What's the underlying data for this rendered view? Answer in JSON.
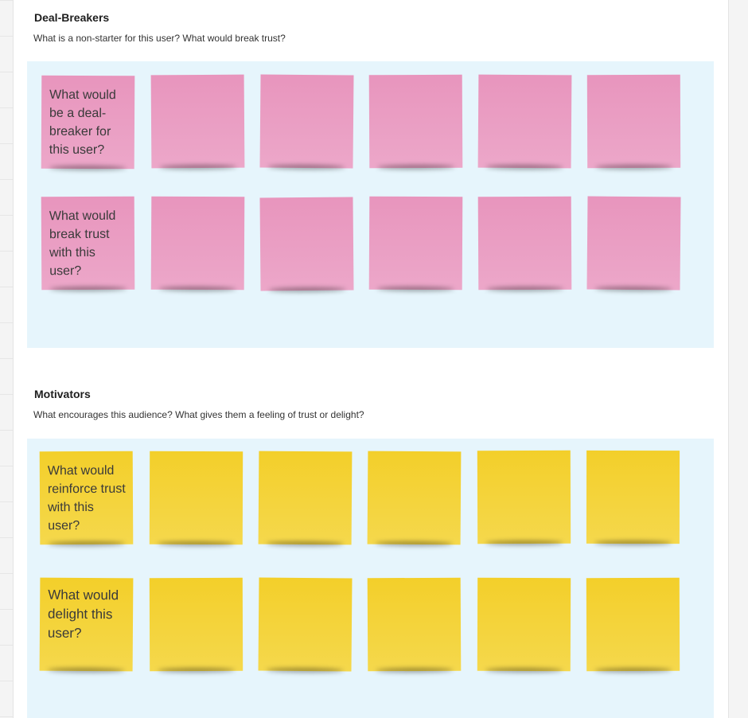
{
  "sections": [
    {
      "id": "deal-breakers",
      "title": "Deal-Breakers",
      "description": "What is a non-starter for this user? What would break trust?",
      "color": "#e99ac1",
      "rows": [
        [
          "What would be a deal-breaker for this user?",
          "",
          "",
          "",
          "",
          ""
        ],
        [
          "What would break trust with this user?",
          "",
          "",
          "",
          "",
          ""
        ]
      ]
    },
    {
      "id": "motivators",
      "title": "Motivators",
      "description": "What encourages this audience? What gives them a feeling of trust or delight?",
      "color": "#f4d233",
      "rows": [
        [
          "What would reinforce trust with this user?",
          "",
          "",
          "",
          "",
          ""
        ],
        [
          "What would delight this user?",
          "",
          "",
          "",
          "",
          ""
        ]
      ]
    }
  ],
  "colors": {
    "zone_background": "#e6f5fc",
    "board_background": "#ffffff",
    "canvas_background": "#f2f2f2"
  }
}
